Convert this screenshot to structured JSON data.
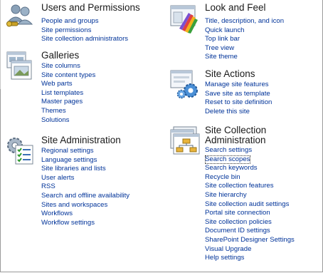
{
  "sections": {
    "users": {
      "title": "Users and Permissions",
      "links": [
        "People and groups",
        "Site permissions",
        "Site collection administrators"
      ]
    },
    "look": {
      "title": "Look and Feel",
      "links": [
        "Title, description, and icon",
        "Quick launch",
        "Top link bar",
        "Tree view",
        "Site theme"
      ]
    },
    "galleries": {
      "title": "Galleries",
      "links": [
        "Site columns",
        "Site content types",
        "Web parts",
        "List templates",
        "Master pages",
        "Themes",
        "Solutions"
      ]
    },
    "actions": {
      "title": "Site Actions",
      "links": [
        "Manage site features",
        "Save site as template",
        "Reset to site definition",
        "Delete this site"
      ]
    },
    "admin": {
      "title": "Site Administration",
      "links": [
        "Regional settings",
        "Language settings",
        "Site libraries and lists",
        "User alerts",
        "RSS",
        "Search and offline availability",
        "Sites and workspaces",
        "Workflows",
        "Workflow settings"
      ]
    },
    "collection": {
      "title_line1": "Site Collection",
      "title_line2": "Administration",
      "focused_link": "Search scopes",
      "links": [
        "Search settings",
        "Search scopes",
        "Search keywords",
        "Recycle bin",
        "Site collection features",
        "Site hierarchy",
        "Site collection audit settings",
        "Portal site connection",
        "Site collection policies",
        "Document ID settings",
        "SharePoint Designer Settings",
        "Visual Upgrade",
        "Help settings"
      ]
    }
  },
  "colors": {
    "link": "#003399",
    "heading": "#1a1a1a"
  }
}
